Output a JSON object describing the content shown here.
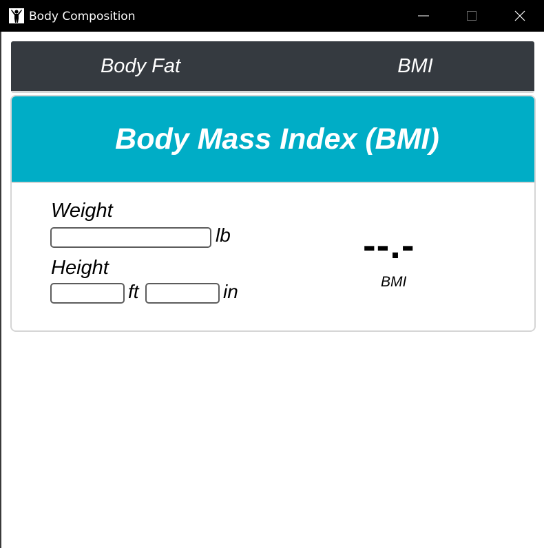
{
  "window": {
    "title": "Body Composition",
    "icon": "person-arms-raised-icon"
  },
  "tabs": [
    {
      "label": "Body Fat"
    },
    {
      "label": "BMI"
    }
  ],
  "bmi_card": {
    "title": "Body Mass Index (BMI)",
    "header_color": "#00adc6",
    "weight": {
      "label": "Weight",
      "value": "",
      "unit": "lb"
    },
    "height": {
      "label": "Height",
      "feet_value": "",
      "feet_unit": "ft",
      "inches_value": "",
      "inches_unit": "in"
    },
    "result": {
      "value": "--.-",
      "label": "BMI"
    }
  },
  "colors": {
    "tabbar_bg": "#353a40",
    "titlebar_bg": "#000000"
  }
}
